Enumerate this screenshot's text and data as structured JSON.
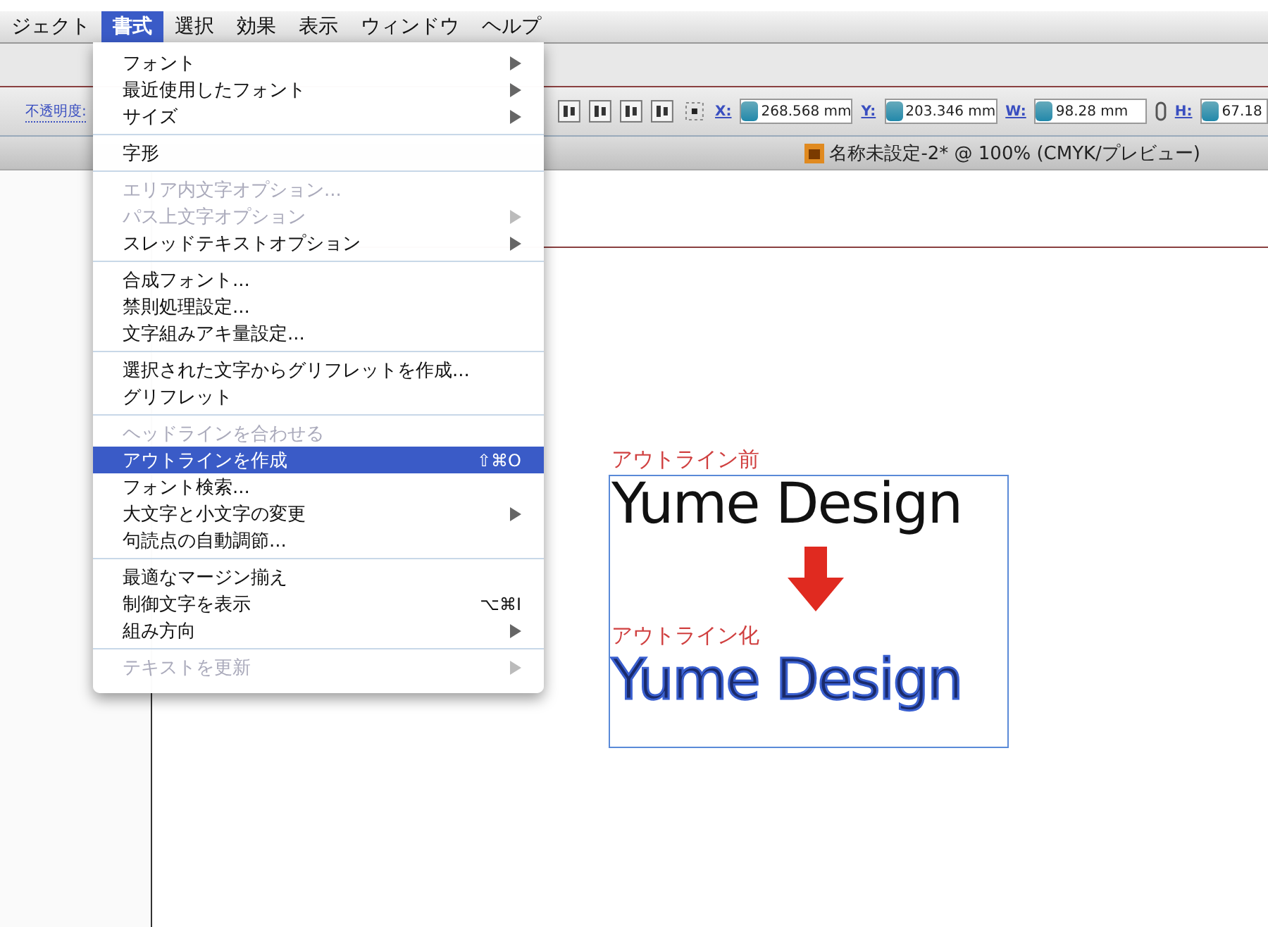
{
  "menubar": [
    {
      "label": "ジェクト",
      "selected": false
    },
    {
      "label": "書式",
      "selected": true
    },
    {
      "label": "選択",
      "selected": false
    },
    {
      "label": "効果",
      "selected": false
    },
    {
      "label": "表示",
      "selected": false
    },
    {
      "label": "ウィンドウ",
      "selected": false
    },
    {
      "label": "ヘルプ",
      "selected": false
    }
  ],
  "control_bar": {
    "opacity_label": "不透明度:",
    "fields": [
      {
        "label": "X:",
        "value": "268.568 mm"
      },
      {
        "label": "Y:",
        "value": "203.346 mm"
      },
      {
        "label": "W:",
        "value": "98.28 mm"
      },
      {
        "label": "H:",
        "value": "67.18"
      }
    ]
  },
  "document": {
    "title": "名称未設定-2* @ 100% (CMYK/プレビュー)"
  },
  "menu": {
    "groups": [
      [
        {
          "label": "フォント",
          "disabled": false,
          "selected": false,
          "submenu": true
        },
        {
          "label": "最近使用したフォント",
          "disabled": false,
          "selected": false,
          "submenu": true
        },
        {
          "label": "サイズ",
          "disabled": false,
          "selected": false,
          "submenu": true
        }
      ],
      [
        {
          "label": "字形",
          "disabled": false,
          "selected": false,
          "submenu": false
        }
      ],
      [
        {
          "label": "エリア内文字オプション...",
          "disabled": true,
          "selected": false,
          "submenu": false
        },
        {
          "label": "パス上文字オプション",
          "disabled": true,
          "selected": false,
          "submenu": true
        },
        {
          "label": "スレッドテキストオプション",
          "disabled": false,
          "selected": false,
          "submenu": true
        }
      ],
      [
        {
          "label": "合成フォント...",
          "disabled": false,
          "selected": false,
          "submenu": false
        },
        {
          "label": "禁則処理設定...",
          "disabled": false,
          "selected": false,
          "submenu": false
        },
        {
          "label": "文字組みアキ量設定...",
          "disabled": false,
          "selected": false,
          "submenu": false
        }
      ],
      [
        {
          "label": "選択された文字からグリフレットを作成...",
          "disabled": false,
          "selected": false,
          "submenu": false
        },
        {
          "label": "グリフレット",
          "disabled": false,
          "selected": false,
          "submenu": false
        }
      ],
      [
        {
          "label": "ヘッドラインを合わせる",
          "disabled": true,
          "selected": false,
          "submenu": false
        },
        {
          "label": "アウトラインを作成",
          "disabled": false,
          "selected": true,
          "submenu": false,
          "shortcut": "⇧⌘O"
        },
        {
          "label": "フォント検索...",
          "disabled": false,
          "selected": false,
          "submenu": false
        },
        {
          "label": "大文字と小文字の変更",
          "disabled": false,
          "selected": false,
          "submenu": true
        },
        {
          "label": "句読点の自動調節...",
          "disabled": false,
          "selected": false,
          "submenu": false
        }
      ],
      [
        {
          "label": "最適なマージン揃え",
          "disabled": false,
          "selected": false,
          "submenu": false
        },
        {
          "label": "制御文字を表示",
          "disabled": false,
          "selected": false,
          "submenu": false,
          "shortcut": "⌥⌘I"
        },
        {
          "label": "組み方向",
          "disabled": false,
          "selected": false,
          "submenu": true
        }
      ],
      [
        {
          "label": "テキストを更新",
          "disabled": true,
          "selected": false,
          "submenu": true
        }
      ]
    ]
  },
  "artwork": {
    "before_label": "アウトライン前",
    "before_text": "Yume Design",
    "after_label": "アウトライン化",
    "after_text": "Yume Design"
  }
}
